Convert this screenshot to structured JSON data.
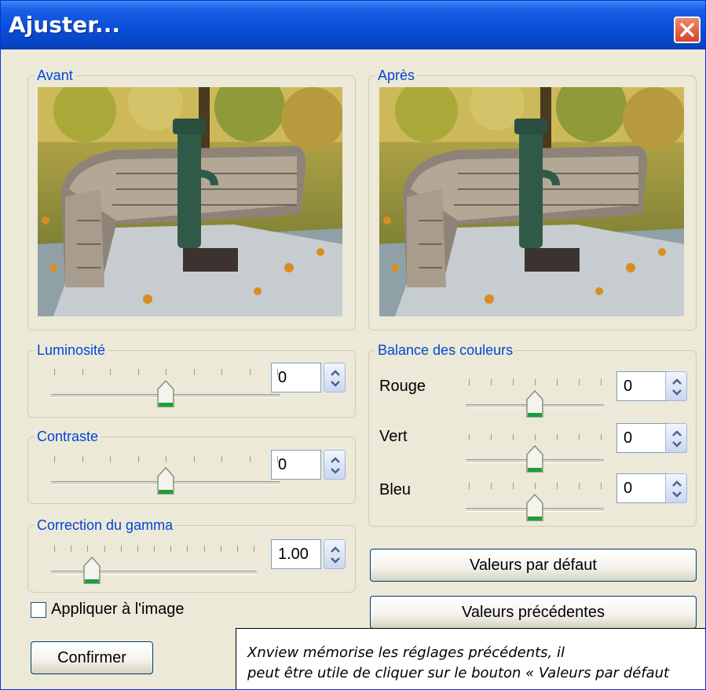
{
  "window": {
    "title": "Ajuster..."
  },
  "groups": {
    "before": "Avant",
    "after": "Après",
    "brightness": "Luminosité",
    "contrast": "Contraste",
    "gamma": "Correction du gamma",
    "color_balance": "Balance des couleurs"
  },
  "controls": {
    "brightness": {
      "value": "0",
      "position": 0.5
    },
    "contrast": {
      "value": "0",
      "position": 0.5
    },
    "gamma": {
      "value": "1.00",
      "position": 0.2
    },
    "red": {
      "label": "Rouge",
      "value": "0",
      "position": 0.5
    },
    "green": {
      "label": "Vert",
      "value": "0",
      "position": 0.5
    },
    "blue": {
      "label": "Bleu",
      "value": "0",
      "position": 0.5
    }
  },
  "buttons": {
    "default_values": "Valeurs par défaut",
    "previous_values": "Valeurs précédentes",
    "confirm": "Confirmer"
  },
  "checkbox": {
    "label": "Appliquer à l'image",
    "checked": false
  },
  "note": {
    "line1": "Xnview mémorise les réglages précédents, il",
    "line2": "peut être utile de cliquer sur le bouton « Valeurs par défaut"
  },
  "colors": {
    "title_bar": "#0a4fd8",
    "group_label": "#0046d5",
    "close_button": "#d5442b",
    "thumb_accent": "#1f9c3b"
  }
}
